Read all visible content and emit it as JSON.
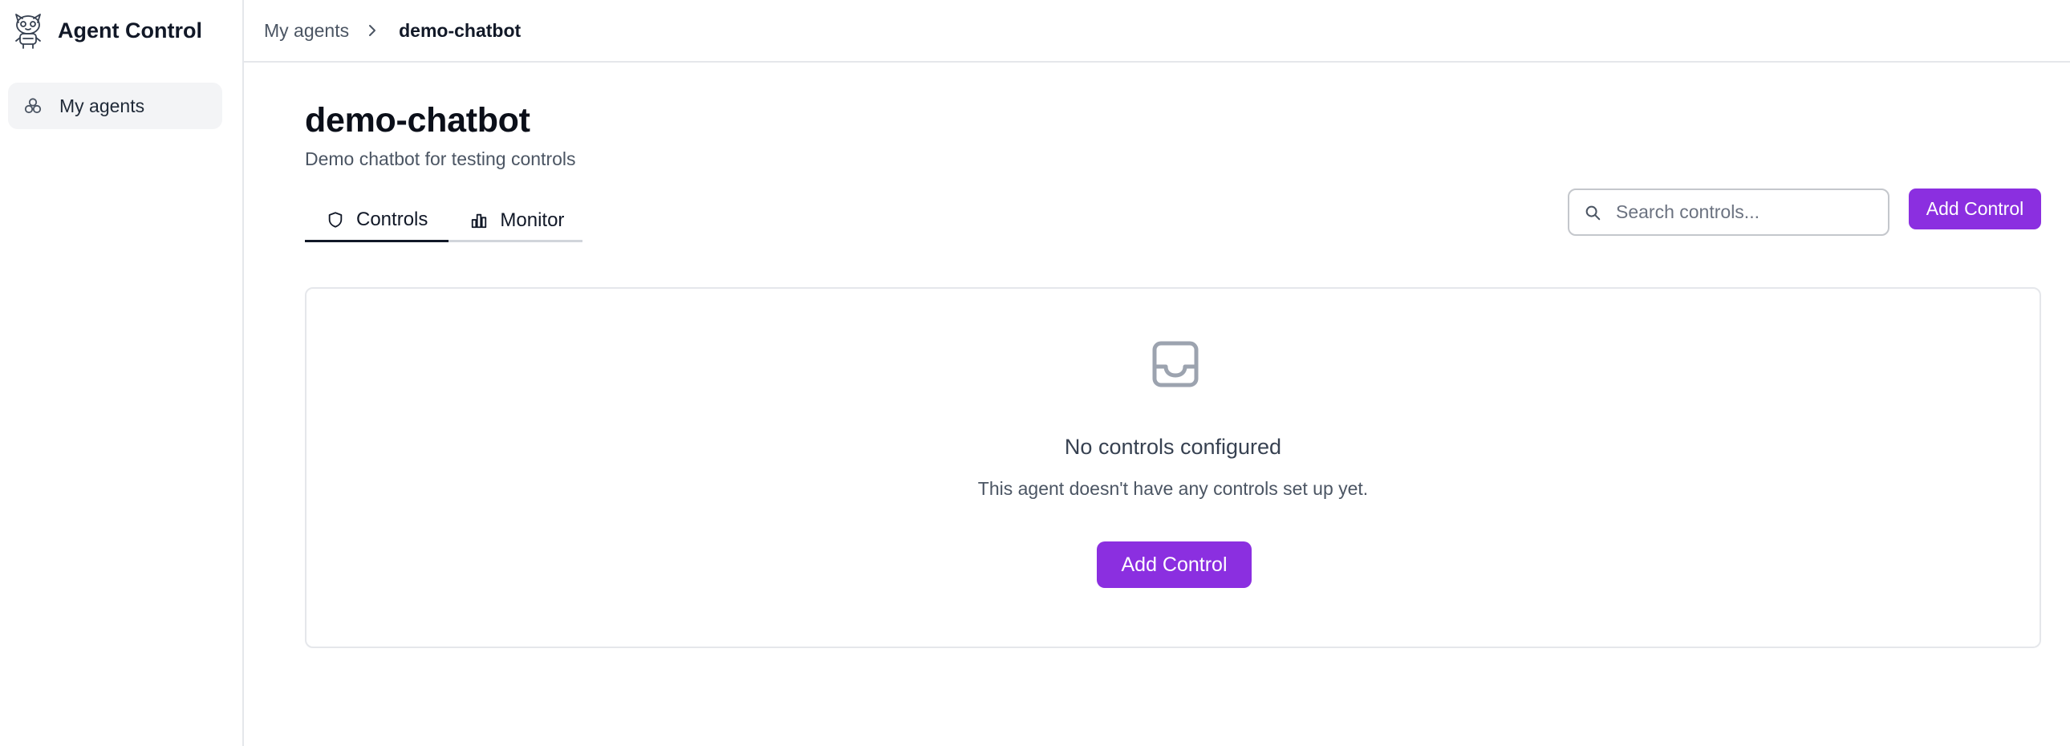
{
  "brand": {
    "title": "Agent Control",
    "logo_icon": "robot-mascot-icon"
  },
  "sidebar": {
    "items": [
      {
        "label": "My agents",
        "icon": "agents-cluster-icon",
        "active": true
      }
    ]
  },
  "breadcrumb": {
    "items": [
      {
        "label": "My agents"
      },
      {
        "label": "demo-chatbot"
      }
    ],
    "separator_icon": "chevron-right-icon"
  },
  "page": {
    "title": "demo-chatbot",
    "subtitle": "Demo chatbot for testing controls"
  },
  "tabs": [
    {
      "label": "Controls",
      "icon": "shield-icon",
      "active": true
    },
    {
      "label": "Monitor",
      "icon": "bar-chart-icon",
      "active": false
    }
  ],
  "search": {
    "placeholder": "Search controls...",
    "value": "",
    "icon": "search-icon"
  },
  "toolbar": {
    "add_control_label": "Add Control"
  },
  "empty_state": {
    "icon": "inbox-icon",
    "title": "No controls configured",
    "text": "This agent doesn't have any controls set up yet.",
    "button_label": "Add Control"
  },
  "colors": {
    "accent": "#8b2fe0",
    "sidebar_active_bg": "#f3f4f6",
    "border": "#e5e7eb",
    "muted_text": "#4b5563"
  }
}
